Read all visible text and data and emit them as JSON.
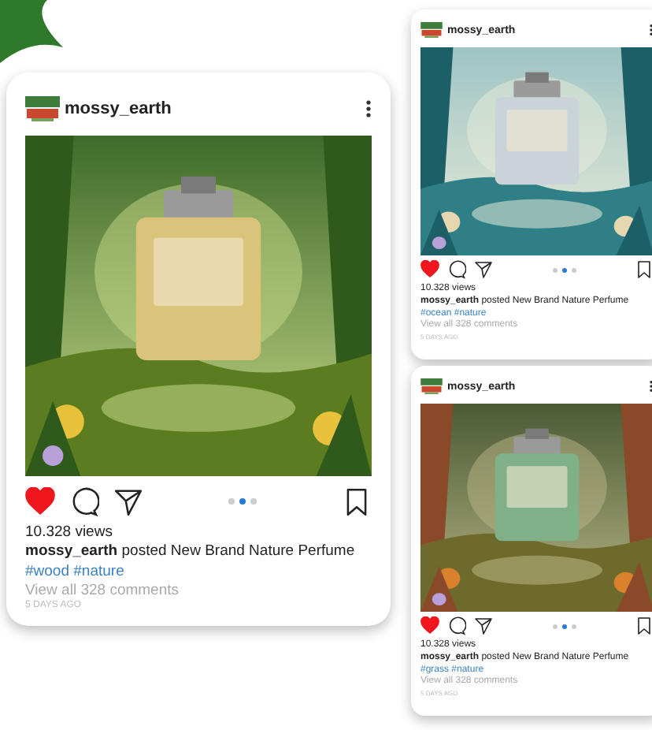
{
  "posts": [
    {
      "username": "mossy_earth",
      "liked": true,
      "dots": [
        {
          "selected": false
        },
        {
          "selected": true
        },
        {
          "selected": false
        }
      ],
      "views": "10.328 views",
      "caption_user": "mossy_earth",
      "caption": "posted New Brand Nature Perfume",
      "tags": "#wood #nature",
      "comments": "View all 328 comments",
      "time": "5 DAYS AGO"
    },
    {
      "username": "mossy_earth",
      "liked": true,
      "dots": [
        {
          "selected": false
        },
        {
          "selected": true
        },
        {
          "selected": false
        }
      ],
      "views": "10.328 views",
      "caption_user": "mossy_earth",
      "caption": "posted New Brand Nature Perfume",
      "tags": "#ocean #nature",
      "comments": "View all 328 comments",
      "time": "5 DAYS AGO"
    },
    {
      "username": "mossy_earth",
      "liked": true,
      "dots": [
        {
          "selected": false
        },
        {
          "selected": true
        },
        {
          "selected": false
        }
      ],
      "views": "10.328 views",
      "caption_user": "mossy_earth",
      "caption": "posted New Brand Nature Perfume",
      "tags": "#grass #nature",
      "comments": "View all 328 comments",
      "time": "5 DAYS AGO"
    }
  ]
}
